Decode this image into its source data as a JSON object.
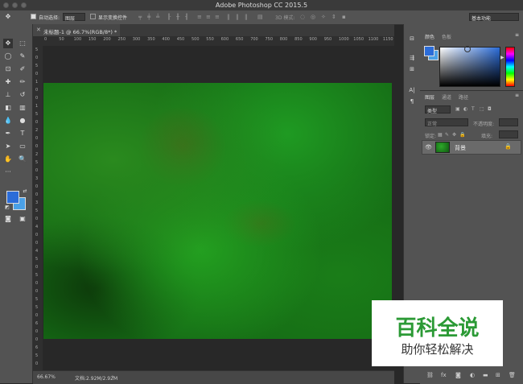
{
  "window": {
    "title": "Adobe Photoshop CC 2015.5"
  },
  "options_bar": {
    "auto_select_label": "自动选择:",
    "auto_select_target": "图层",
    "show_transform_label": "显示变换控件",
    "mode_3d_label": "3D 模式:",
    "workspace": "基本功能"
  },
  "document": {
    "tab_title": "未标题-1 @ 66.7%(RGB/8*) *"
  },
  "ruler": {
    "h_ticks": [
      "0",
      "50",
      "100",
      "150",
      "200",
      "250",
      "300",
      "350",
      "400",
      "450",
      "500",
      "550",
      "600",
      "650",
      "700",
      "750",
      "800",
      "850",
      "900",
      "950",
      "1000",
      "1050",
      "1100",
      "1150",
      "120"
    ],
    "v_ticks": [
      "5",
      "0",
      "5",
      "0",
      "1",
      "0",
      "0",
      "1",
      "5",
      "0",
      "2",
      "0",
      "0",
      "2",
      "5",
      "0",
      "3",
      "0",
      "0",
      "3",
      "5",
      "0",
      "4",
      "0",
      "0",
      "4",
      "5",
      "0",
      "5",
      "0",
      "0",
      "5",
      "5",
      "0",
      "6",
      "0",
      "0",
      "6",
      "5",
      "0"
    ]
  },
  "status": {
    "zoom": "66.67%",
    "doc_info": "文档:2.92M/2.92M"
  },
  "color_panel": {
    "tab_color": "颜色",
    "tab_swatches": "色板",
    "foreground": "#2b6cd8",
    "background": "#4aa0e6"
  },
  "layers_panel": {
    "tabs": [
      "图层",
      "通道",
      "路径"
    ],
    "kind_filter": "类型",
    "blend_mode": "正常",
    "opacity_label": "不透明度:",
    "lock_label": "锁定:",
    "fill_label": "填充:",
    "layers": [
      {
        "name": "背景",
        "visible": true,
        "locked": true
      }
    ]
  },
  "watermark": {
    "title": "百科全说",
    "subtitle": "助你轻松解决"
  },
  "colors": {
    "canvas_green": "#1f8f1f",
    "panel_bg": "#535353",
    "app_bg": "#282828"
  }
}
